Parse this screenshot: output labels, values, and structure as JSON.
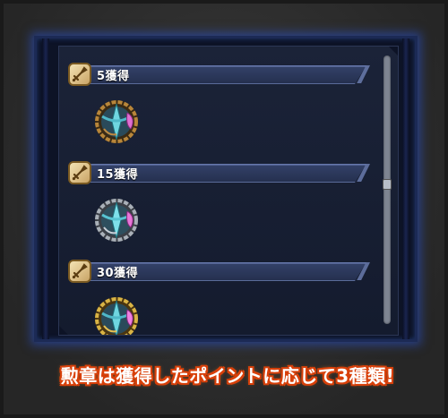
{
  "rewards": [
    {
      "label": "5獲得",
      "medal": "bronze-medal-icon",
      "rim_color": "#b8863a"
    },
    {
      "label": "15獲得",
      "medal": "silver-medal-icon",
      "rim_color": "#a9b0b8"
    },
    {
      "label": "30獲得",
      "medal": "gold-medal-icon",
      "rim_color": "#d9b445"
    }
  ],
  "caption": "勲章は獲得したポイントに応じて3種類!",
  "colors": {
    "frame_glow": "#2850c8",
    "panel_bg": "#1b2338",
    "caption_outline": "#d8400a"
  }
}
